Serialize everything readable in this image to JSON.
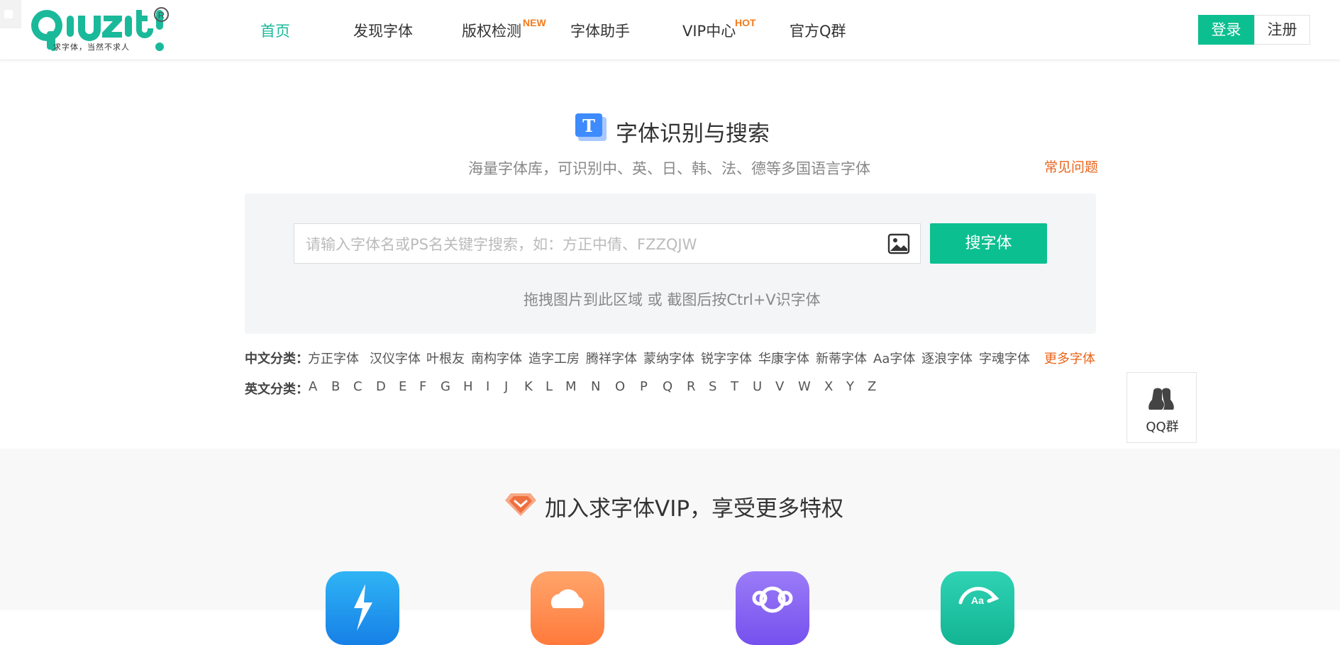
{
  "header": {
    "logo_tagline": "求字体，当然不求人",
    "nav": [
      {
        "label": "首页",
        "badge": ""
      },
      {
        "label": "发现字体",
        "badge": ""
      },
      {
        "label": "版权检测",
        "badge": "NEW"
      },
      {
        "label": "字体助手",
        "badge": ""
      },
      {
        "label": "VIP中心",
        "badge": "HOT"
      },
      {
        "label": "官方Q群",
        "badge": ""
      }
    ],
    "login_label": "登录",
    "register_label": "注册"
  },
  "search": {
    "title": "字体识别与搜索",
    "subtitle": "海量字体库，可识别中、英、日、韩、法、德等多国语言字体",
    "faq_label": "常见问题",
    "placeholder": "请输入字体名或PS名关键字搜索，如：方正中倩、FZZQJW",
    "button_label": "搜字体",
    "drop_hint": "拖拽图片到此区域 或 截图后按Ctrl+V识字体"
  },
  "categories": {
    "chinese_label": "中文分类：",
    "chinese": [
      "方正字体",
      "汉仪字体",
      "叶根友",
      "南构字体",
      "造字工房",
      "腾祥字体",
      "蒙纳字体",
      "锐字字体",
      "华康字体",
      "新蒂字体",
      "Aa字体",
      "逐浪字体",
      "字魂字体"
    ],
    "more_label": "更多字体",
    "english_label": "英文分类：",
    "english": [
      "A",
      "B",
      "C",
      "D",
      "E",
      "F",
      "G",
      "H",
      "I",
      "J",
      "K",
      "L",
      "M",
      "N",
      "O",
      "P",
      "Q",
      "R",
      "S",
      "T",
      "U",
      "V",
      "W",
      "X",
      "Y",
      "Z"
    ]
  },
  "qq_float": {
    "label": "QQ群"
  },
  "vip": {
    "title": "加入求字体VIP，享受更多特权"
  },
  "colors": {
    "accent": "#0cbf90",
    "orange": "#e8641b",
    "badge": "#f37b1d"
  },
  "icons": [
    "text-t-icon",
    "image-upload-icon",
    "qq-icon",
    "diamond-icon",
    "lightning-icon",
    "cloud-icon",
    "crown-icon",
    "font-refresh-icon"
  ]
}
